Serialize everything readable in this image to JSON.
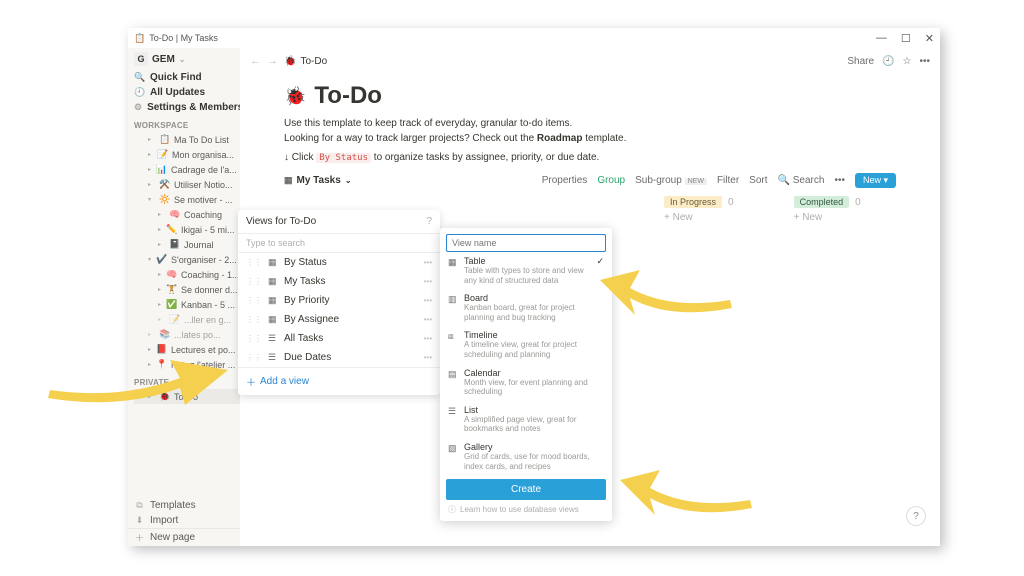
{
  "titlebar": {
    "doc_icon": "📋",
    "title": "To-Do | My Tasks"
  },
  "window_controls": {
    "min": "—",
    "max": "☐",
    "close": "✕"
  },
  "sidebar": {
    "workspace_icon": "G",
    "workspace_name": "GEM",
    "quick_find": "Quick Find",
    "all_updates": "All Updates",
    "settings": "Settings & Members",
    "section_workspace": "WORKSPACE",
    "pages": [
      {
        "icon": "📋",
        "label": "Ma To Do List"
      },
      {
        "icon": "📝",
        "label": "Mon organisa..."
      },
      {
        "icon": "📊",
        "label": "Cadrage de l'a..."
      },
      {
        "icon": "⚒️",
        "label": "Utiliser Notio..."
      },
      {
        "icon": "🔆",
        "label": "Se motiver - ...",
        "open": true
      },
      {
        "icon": "🧠",
        "label": "Coaching",
        "level": 2
      },
      {
        "icon": "✏️",
        "label": "Ikigai - 5 mi...",
        "level": 2
      },
      {
        "icon": "📓",
        "label": "Journal",
        "level": 2
      },
      {
        "icon": "✔️",
        "label": "S'organiser - 2...",
        "open": true
      },
      {
        "icon": "🧠",
        "label": "Coaching - 1...",
        "level": 2
      },
      {
        "icon": "🏋️",
        "label": "Se donner d...",
        "level": 2
      },
      {
        "icon": "✅",
        "label": "Kanban - 5 ...",
        "level": 2
      },
      {
        "icon": "📝",
        "label": "...ller en g...",
        "level": 2,
        "faded": true
      },
      {
        "icon": "📚",
        "label": "...lates po...",
        "level": 1,
        "faded": true
      },
      {
        "icon": "📕",
        "label": "Lectures et po..."
      },
      {
        "icon": "📍",
        "label": "Notez l'atelier ..."
      }
    ],
    "section_private": "PRIVATE",
    "private_pages": [
      {
        "icon": "🐞",
        "label": "To-Do"
      }
    ],
    "footer": {
      "templates": "Templates",
      "import": "Import",
      "new_page": "New page"
    }
  },
  "topbar": {
    "crumb_icon": "🐞",
    "crumb_label": "To-Do",
    "share": "Share"
  },
  "page": {
    "emoji": "🐞",
    "title": "To-Do",
    "desc_line1": "Use this template to keep track of everyday, granular to-do items.",
    "desc_line2_a": "Looking for a way to track larger projects? Check out the ",
    "desc_roadmap": "Roadmap",
    "desc_line2_b": " template.",
    "hint_prefix": "↓ Click ",
    "hint_code": "By Status",
    "hint_suffix": " to organize tasks by assignee, priority, or due date."
  },
  "db": {
    "current_view": "My Tasks",
    "properties": "Properties",
    "group": "Group",
    "subgroup": "Sub-group",
    "new_badge": "NEW",
    "filter": "Filter",
    "sort": "Sort",
    "search": "Search",
    "new": "New"
  },
  "board": {
    "col1": "In Progress",
    "col1_count": "0",
    "col2": "Completed",
    "col2_count": "0",
    "new_row": "+  New"
  },
  "views_panel": {
    "title": "Views for To-Do",
    "search_ph": "Type to search",
    "items": [
      "By Status",
      "My Tasks",
      "By Priority",
      "By Assignee",
      "All Tasks",
      "Due Dates"
    ],
    "add": "Add a view"
  },
  "modal": {
    "input_ph": "View name",
    "types": [
      {
        "name": "Table",
        "desc": "Table with types to store and view any kind of structured data",
        "selected": true
      },
      {
        "name": "Board",
        "desc": "Kanban board, great for project planning and bug tracking"
      },
      {
        "name": "Timeline",
        "desc": "A timeline view, great for project scheduling and planning"
      },
      {
        "name": "Calendar",
        "desc": "Month view, for event planning and scheduling"
      },
      {
        "name": "List",
        "desc": "A simplified page view, great for bookmarks and notes"
      },
      {
        "name": "Gallery",
        "desc": "Grid of cards, use for mood boards, index cards, and recipes"
      }
    ],
    "create": "Create",
    "learn": "Learn how to use database views"
  }
}
